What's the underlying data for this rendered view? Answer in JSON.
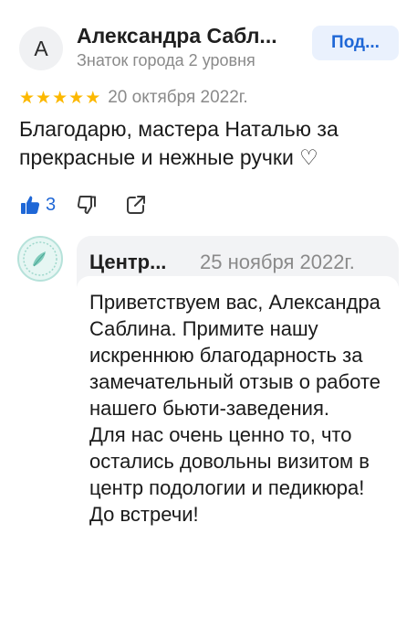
{
  "review": {
    "author": {
      "initial": "А",
      "name": "Александра Сабл...",
      "level": "Знаток города 2 уровня"
    },
    "subscribe_label": "Под...",
    "rating": 5,
    "stars": [
      "★",
      "★",
      "★",
      "★",
      "★"
    ],
    "date": "20 октября 2022г.",
    "text": "Благодарю, мастера Наталью за прекрасные и нежные ручки ♡",
    "likes": "3",
    "icons": {
      "like": "thumbs-up-icon",
      "dislike": "thumbs-down-icon",
      "share": "share-icon"
    }
  },
  "reply": {
    "org_name": "Центр...",
    "date": "25 ноября 2022г.",
    "paragraphs": [
      "Приветствуем вас, Александра Саблина. Примите нашу искреннюю благодарность за замечательный отзыв о работе нашего бьюти-заведения.",
      "Для нас очень ценно то, что остались довольны визитом в центр подологии и педикюра! До встречи!"
    ]
  },
  "colors": {
    "accent": "#1f67d6",
    "star": "#fcb800",
    "secondary_text": "#8a8a8a",
    "reply_background": "#f2f3f5"
  }
}
